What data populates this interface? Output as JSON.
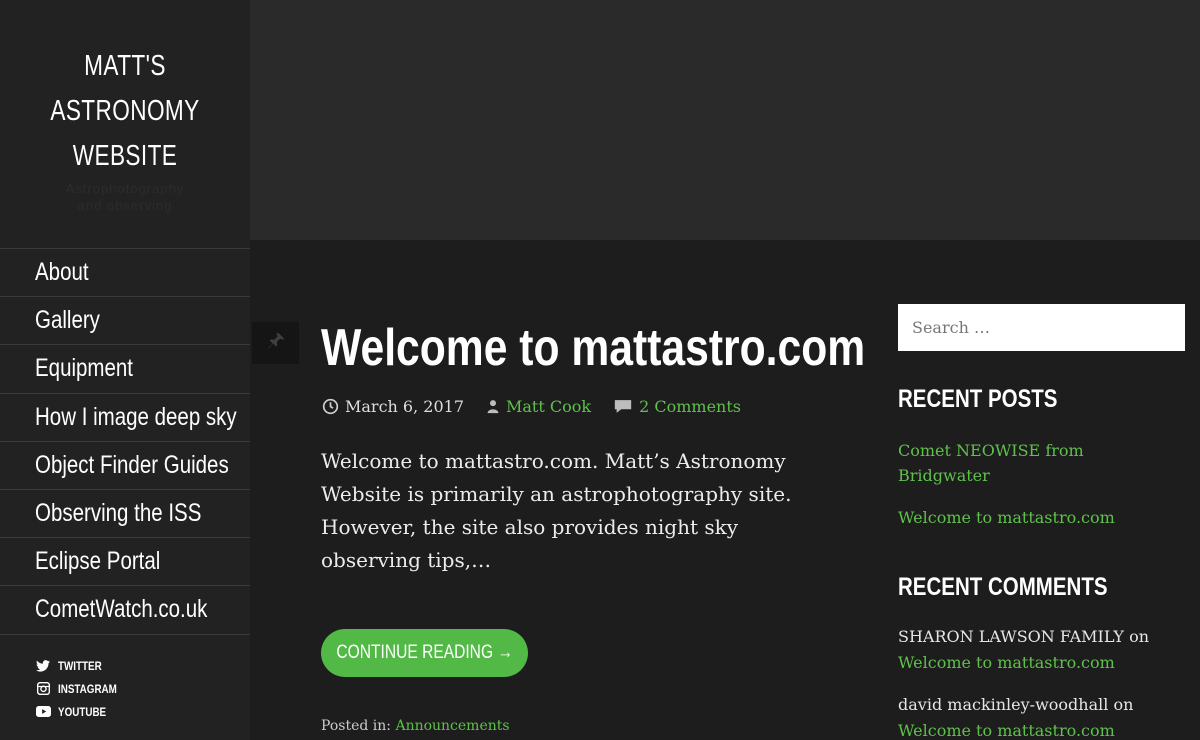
{
  "site": {
    "title_lines": [
      "MATT'S",
      "ASTRONOMY",
      "WEBSITE"
    ],
    "tagline_lines": [
      "Astrophotography",
      "and observing"
    ]
  },
  "nav": {
    "items": [
      {
        "label": "About"
      },
      {
        "label": "Gallery"
      },
      {
        "label": "Equipment"
      },
      {
        "label": "How I image deep sky"
      },
      {
        "label": "Object Finder Guides"
      },
      {
        "label": "Observing the ISS"
      },
      {
        "label": "Eclipse Portal"
      },
      {
        "label": "CometWatch.co.uk"
      }
    ]
  },
  "social": {
    "items": [
      {
        "label": "TWITTER",
        "icon": "twitter-icon"
      },
      {
        "label": "INSTAGRAM",
        "icon": "instagram-icon"
      },
      {
        "label": "YOUTUBE",
        "icon": "youtube-icon"
      }
    ]
  },
  "post": {
    "title": "Welcome to mattastro.com",
    "date": "March 6, 2017",
    "author": "Matt Cook",
    "comments": "2 Comments",
    "excerpt": "Welcome to mattastro.com. Matt’s Astronomy Website is primarily an astrophotography site. However, the site also provides night sky observing tips,…",
    "continue_label": "CONTINUE READING →",
    "posted_in_label": "Posted in:",
    "category": "Announcements"
  },
  "search": {
    "placeholder": "Search …"
  },
  "recent_posts": {
    "title": "RECENT POSTS",
    "items": [
      "Comet NEOWISE from Bridgwater",
      "Welcome to mattastro.com"
    ]
  },
  "recent_comments": {
    "title": "RECENT COMMENTS",
    "items": [
      {
        "author": "SHARON LAWSON FAMILY",
        "on": "on",
        "post": "Welcome to mattastro.com"
      },
      {
        "author": "david mackinley-woodhall",
        "on": "on",
        "post": "Welcome to mattastro.com"
      }
    ]
  },
  "colors": {
    "accent": "#5fc14c",
    "button": "#52b947",
    "sidebar_bg": "#222222",
    "page_bg": "#1d1d1d",
    "header_band": "#2a2a2a"
  }
}
